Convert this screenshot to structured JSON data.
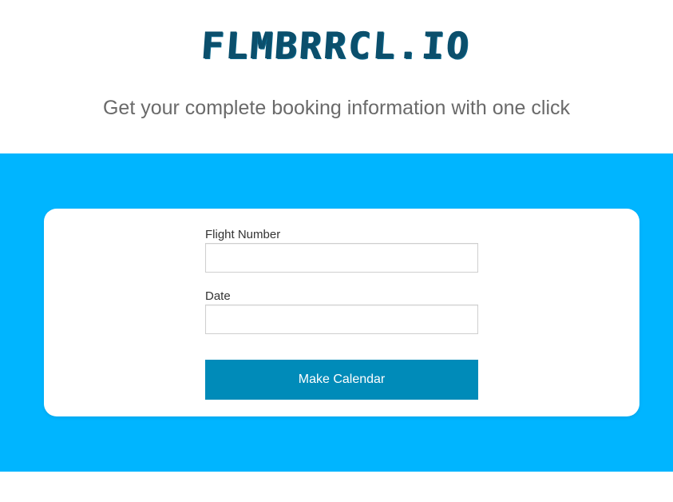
{
  "header": {
    "logo": "FLMBRRCL.IO",
    "tagline": "Get your complete booking information with one click"
  },
  "form": {
    "flight_number_label": "Flight Number",
    "flight_number_value": "",
    "date_label": "Date",
    "date_value": "",
    "submit_label": "Make Calendar"
  },
  "colors": {
    "band": "#00b5ff",
    "button": "#008bb9",
    "logo": "#0b4f6c",
    "tagline": "#6a6a6a"
  }
}
